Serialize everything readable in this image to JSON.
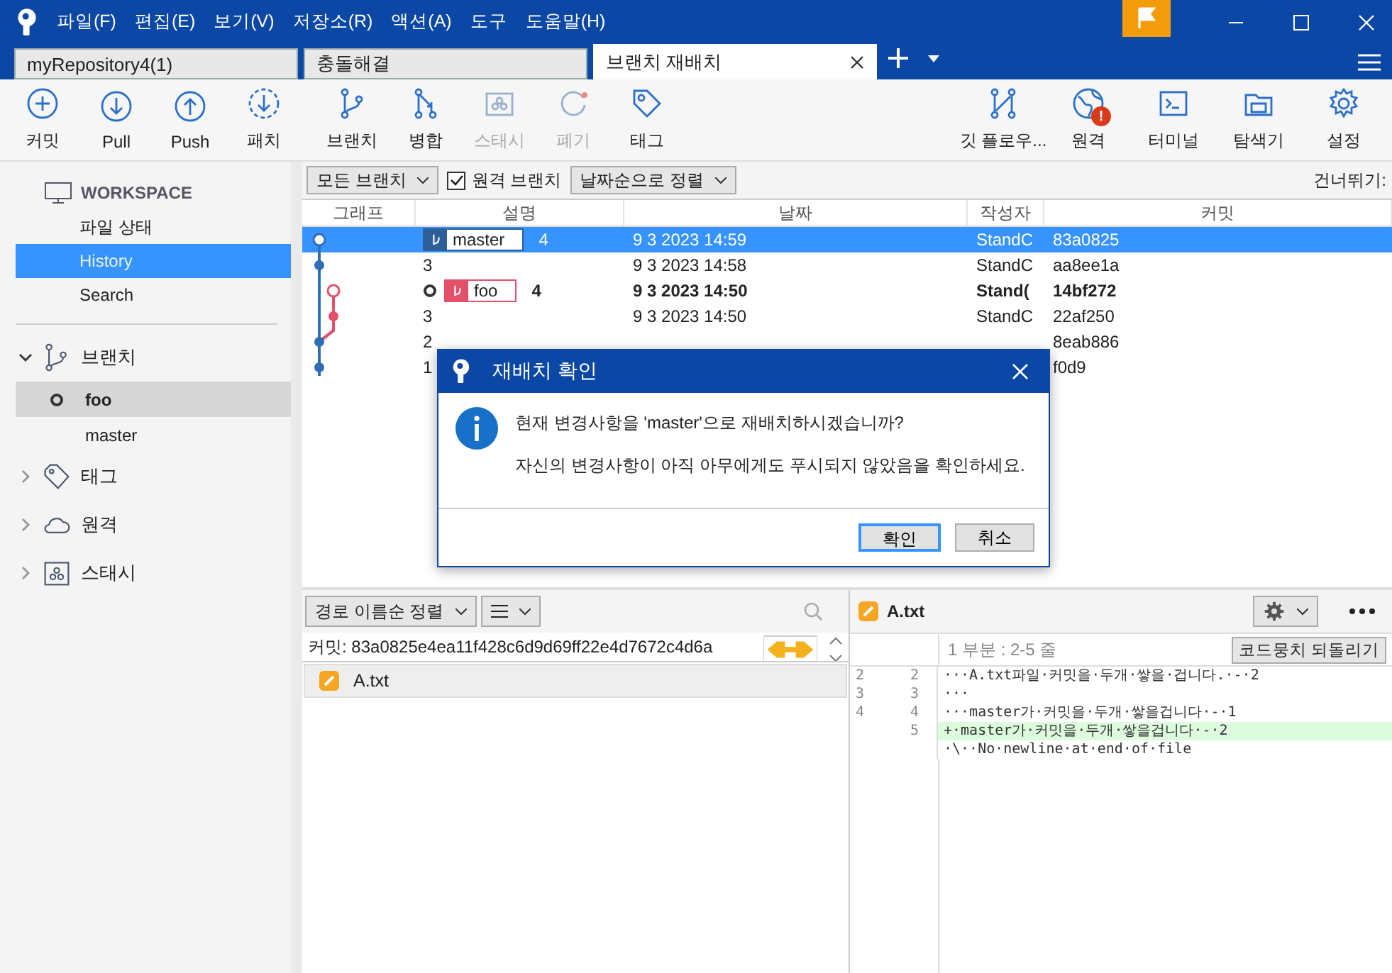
{
  "menu": [
    "파일(F)",
    "편집(E)",
    "보기(V)",
    "저장소(R)",
    "액션(A)",
    "도구",
    "도움말(H)"
  ],
  "tabs": [
    {
      "label": "myRepository4(1)",
      "selected": false
    },
    {
      "label": "충돌해결",
      "selected": false
    },
    {
      "label": "브랜치 재배치",
      "selected": true
    }
  ],
  "toolbar_left": [
    {
      "label": "커밋",
      "kind": "commit",
      "disabled": false
    },
    {
      "label": "Pull",
      "kind": "pull",
      "disabled": false
    },
    {
      "label": "Push",
      "kind": "push",
      "disabled": false
    },
    {
      "label": "패치",
      "kind": "patch",
      "disabled": false
    },
    {
      "label": "브랜치",
      "kind": "branch",
      "disabled": false
    },
    {
      "label": "병합",
      "kind": "merge",
      "disabled": false
    },
    {
      "label": "스태시",
      "kind": "stash",
      "disabled": true
    },
    {
      "label": "폐기",
      "kind": "discard",
      "disabled": true
    },
    {
      "label": "태그",
      "kind": "tag",
      "disabled": false
    }
  ],
  "toolbar_right": [
    {
      "label": "깃 플로우...",
      "kind": "flow"
    },
    {
      "label": "원격",
      "kind": "remote",
      "badge": "!"
    },
    {
      "label": "터미널",
      "kind": "terminal"
    },
    {
      "label": "탐색기",
      "kind": "explorer"
    },
    {
      "label": "설정",
      "kind": "settings"
    }
  ],
  "sidebar": {
    "workspace": "WORKSPACE",
    "items": [
      {
        "label": "파일 상태",
        "selected": false
      },
      {
        "label": "History",
        "selected": true
      },
      {
        "label": "Search",
        "selected": false
      }
    ],
    "sections": [
      {
        "label": "브랜치",
        "kind": "branch",
        "expanded": true,
        "children": [
          {
            "label": "foo",
            "current": true,
            "selected": true
          },
          {
            "label": "master",
            "current": false,
            "selected": false
          }
        ]
      },
      {
        "label": "태그",
        "kind": "tag",
        "expanded": false
      },
      {
        "label": "원격",
        "kind": "remote",
        "expanded": false
      },
      {
        "label": "스태시",
        "kind": "stash",
        "expanded": false
      }
    ]
  },
  "filters": {
    "branches": "모든 브랜치",
    "remote": {
      "label": "원격 브랜치",
      "checked": true
    },
    "sort": "날짜순으로 정렬",
    "jump": "건너뛰기:"
  },
  "columns": [
    "그래프",
    "설명",
    "날짜",
    "작성자",
    "커밋"
  ],
  "rows": [
    {
      "tag": {
        "label": "master",
        "color": "#2d5f9a"
      },
      "head": false,
      "description": "4",
      "date": "9 3 2023 14:59",
      "author": "StandC",
      "commit": "83a0825",
      "selected": true,
      "bold": false
    },
    {
      "head": false,
      "description": "3",
      "date": "9 3 2023 14:58",
      "author": "StandC",
      "commit": "aa8ee1a",
      "selected": false,
      "bold": false
    },
    {
      "tag": {
        "label": "foo",
        "color": "#e4506a"
      },
      "head": true,
      "description": "4",
      "date": "9 3 2023 14:50",
      "author": "Stand(",
      "commit": "14bf272",
      "selected": false,
      "bold": true
    },
    {
      "head": false,
      "description": "3",
      "date": "9 3 2023 14:50",
      "author": "StandC",
      "commit": "22af250",
      "selected": false,
      "bold": false
    },
    {
      "head": false,
      "description": "2",
      "commit": "8eab886",
      "selected": false,
      "bold": false
    },
    {
      "head": false,
      "description": "1",
      "commit": "f0d9",
      "selected": false,
      "bold": false
    }
  ],
  "dialog": {
    "title": "재배치 확인",
    "message": "현재 변경사항을 'master'으로 재배치하시겠습니까?",
    "note": "자신의 변경사항이 아직 아무에게도 푸시되지 않았음을 확인하세요.",
    "buttons": [
      {
        "label": "확인",
        "default": true
      },
      {
        "label": "취소",
        "default": false
      }
    ]
  },
  "files_pane": {
    "sort": "경로 이름순 정렬",
    "commit_info": "커밋: 83a0825e4ea11f428c6d9d69ff22e4d7672c4d6a",
    "files": [
      {
        "name": "A.txt",
        "selected": true
      }
    ]
  },
  "diff": {
    "file": "A.txt",
    "hunk": "1 부분 : 2-5 줄",
    "revert": "코드뭉치 되돌리기",
    "lines": [
      {
        "old": "2",
        "new": "2",
        "text": "···A.txt파일·커밋을·두개·쌓을·겁니다.·-·2",
        "kind": "context"
      },
      {
        "old": "3",
        "new": "3",
        "text": "···",
        "kind": "context"
      },
      {
        "old": "4",
        "new": "4",
        "text": "···master가·커밋을·두개·쌓을겁니다·-·1",
        "kind": "context"
      },
      {
        "new": "5",
        "text": "+·master가·커밋을·두개·쌓을겁니다·-·2",
        "kind": "added"
      },
      {
        "text": "·\\··No·newline·at·end·of·file",
        "kind": "context"
      }
    ]
  }
}
